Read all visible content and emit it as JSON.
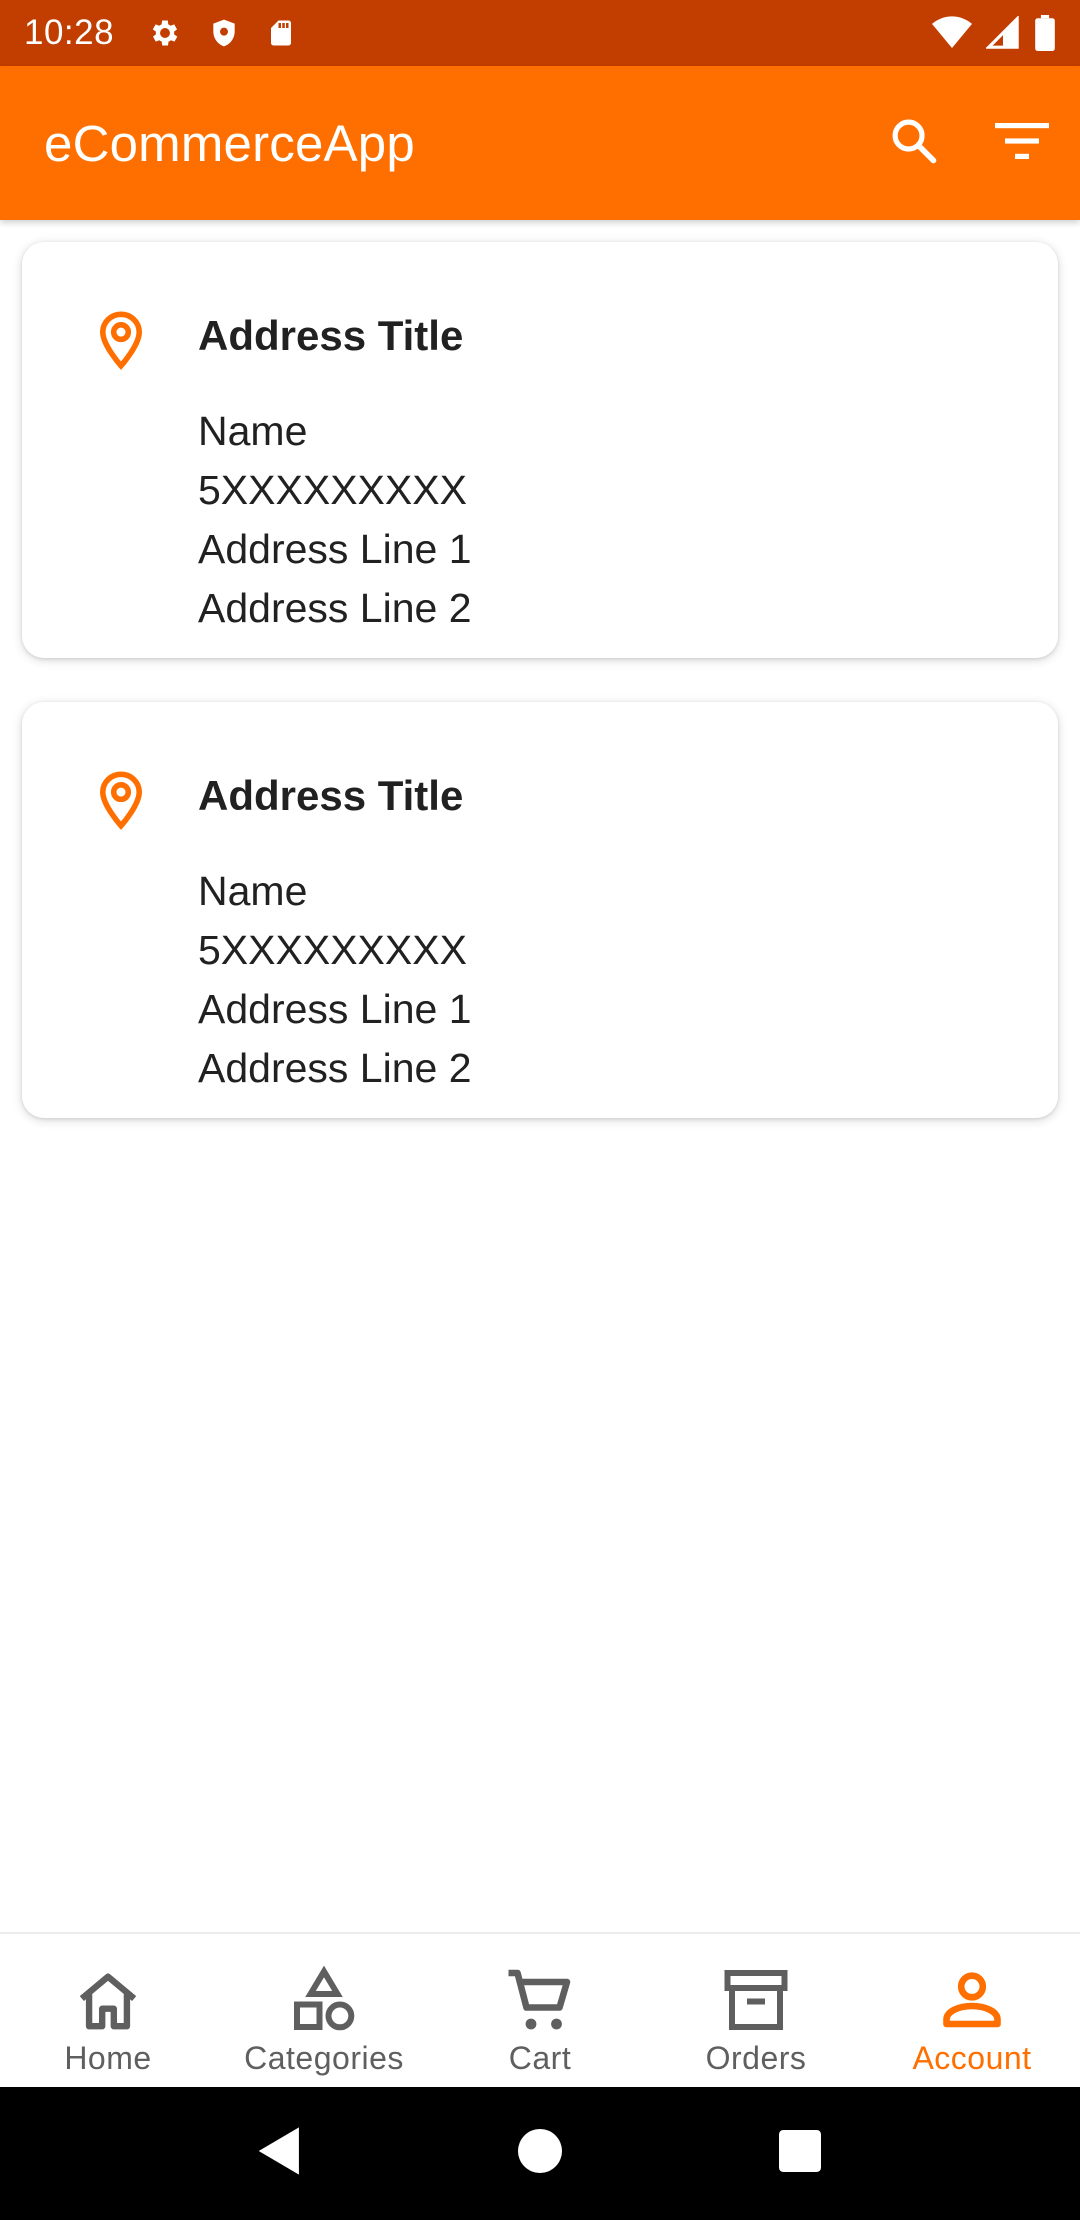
{
  "status_bar": {
    "time": "10:28",
    "left_icons": [
      "gear-icon",
      "shield-icon",
      "sd-card-icon"
    ],
    "right_icons": [
      "wifi-icon",
      "signal-icon",
      "battery-icon"
    ],
    "background": "#C13E00"
  },
  "app_bar": {
    "title": "eCommerceApp",
    "actions": [
      "search-icon",
      "filter-icon"
    ],
    "background": "#FF6F00"
  },
  "addresses": [
    {
      "title": "Address Title",
      "name": "Name",
      "phone": "5XXXXXXXXX",
      "line1": "Address Line 1",
      "line2": "Address Line 2"
    },
    {
      "title": "Address Title",
      "name": "Name",
      "phone": "5XXXXXXXXX",
      "line1": "Address Line 1",
      "line2": "Address Line 2"
    }
  ],
  "bottom_nav": {
    "items": [
      {
        "label": "Home",
        "icon": "home-icon",
        "active": false
      },
      {
        "label": "Categories",
        "icon": "categories-icon",
        "active": false
      },
      {
        "label": "Cart",
        "icon": "cart-icon",
        "active": false
      },
      {
        "label": "Orders",
        "icon": "orders-icon",
        "active": false
      },
      {
        "label": "Account",
        "icon": "account-icon",
        "active": true
      }
    ],
    "active_color": "#FF6F00",
    "inactive_color": "#5f5f5f"
  },
  "system_nav": {
    "buttons": [
      "back-icon",
      "home-circle-icon",
      "recents-icon"
    ]
  }
}
